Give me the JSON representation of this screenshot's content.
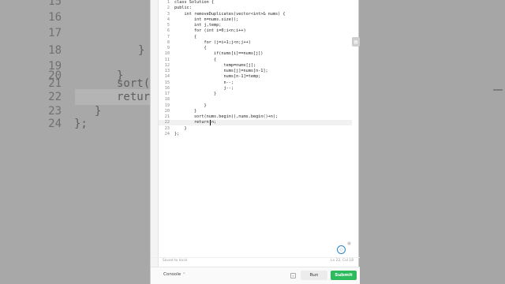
{
  "background_editor": {
    "lines": [
      {
        "num": "15",
        "code": "",
        "active": false
      },
      {
        "num": "16",
        "code": "",
        "active": false
      },
      {
        "num": "17",
        "code": "",
        "active": false
      },
      {
        "num": "18",
        "code": "}",
        "active": false
      },
      {
        "num": "19",
        "code": "",
        "active": false
      },
      {
        "num": "20",
        "code": "}",
        "active": false
      },
      {
        "num": "21",
        "code": "sort(n",
        "active": false
      },
      {
        "num": "22",
        "code": "return",
        "active": true
      },
      {
        "num": "23",
        "code": "}",
        "active": false
      },
      {
        "num": "24",
        "code": "};",
        "active": false
      }
    ]
  },
  "editor": {
    "lines": [
      {
        "num": "1",
        "text": "class Solution {"
      },
      {
        "num": "2",
        "text": "public:"
      },
      {
        "num": "3",
        "text": "    int removeDuplicates(vector<int>& nums) {"
      },
      {
        "num": "4",
        "text": "        int n=nums.size();"
      },
      {
        "num": "5",
        "text": "        int j,temp;"
      },
      {
        "num": "6",
        "text": "        for (int i=0;i<n;i++)"
      },
      {
        "num": "7",
        "text": "        {"
      },
      {
        "num": "8",
        "text": "            for (j=i+1;j<n;j++)"
      },
      {
        "num": "9",
        "text": "            {"
      },
      {
        "num": "10",
        "text": "                if(nums[i]==nums[j])"
      },
      {
        "num": "11",
        "text": "                {"
      },
      {
        "num": "12",
        "text": "                    temp=nums[j];"
      },
      {
        "num": "13",
        "text": "                    nums[j]=nums[n-1];"
      },
      {
        "num": "14",
        "text": "                    nums[n-1]=temp;"
      },
      {
        "num": "15",
        "text": "                    n--;"
      },
      {
        "num": "16",
        "text": "                    j--;"
      },
      {
        "num": "17",
        "text": "                }"
      },
      {
        "num": "18",
        "text": ""
      },
      {
        "num": "19",
        "text": "            }"
      },
      {
        "num": "20",
        "text": "        }"
      },
      {
        "num": "21",
        "text": "        sort(nums.begin(),nums.begin()+n);"
      },
      {
        "num": "22",
        "text": "        return n;"
      },
      {
        "num": "23",
        "text": "    }"
      },
      {
        "num": "24",
        "text": "};"
      }
    ],
    "active_line": "22"
  },
  "status": {
    "saved": "Saved to local",
    "position": "Ln 22, Col 18"
  },
  "bottom_bar": {
    "console_label": "Console",
    "run_label": "Run",
    "submit_label": "Submit"
  },
  "colors": {
    "submit": "#2cbb5d",
    "keyword": "#2b6fb6"
  },
  "icons": {
    "side_tool": "file-icon",
    "chat": "chat-icon",
    "console_toggle": "chevron-up-icon",
    "misc": "note-icon"
  }
}
